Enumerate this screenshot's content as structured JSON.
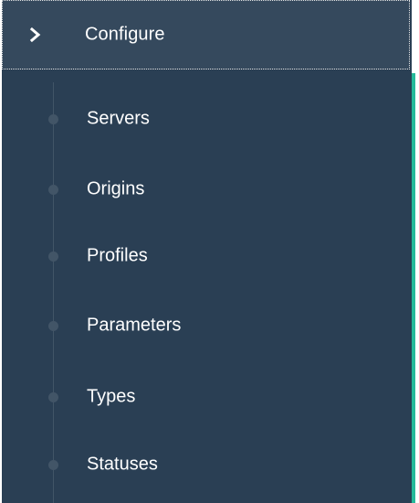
{
  "menu": {
    "header": {
      "label": "Configure",
      "icon": "chevron-right-icon"
    },
    "items": [
      {
        "label": "Servers"
      },
      {
        "label": "Origins"
      },
      {
        "label": "Profiles"
      },
      {
        "label": "Parameters"
      },
      {
        "label": "Types"
      },
      {
        "label": "Statuses"
      }
    ]
  },
  "colors": {
    "sidebar_bg": "#2a3f54",
    "header_bg": "#35495d",
    "accent": "#26b99a",
    "text": "#ffffff",
    "tree_line": "#425567"
  }
}
